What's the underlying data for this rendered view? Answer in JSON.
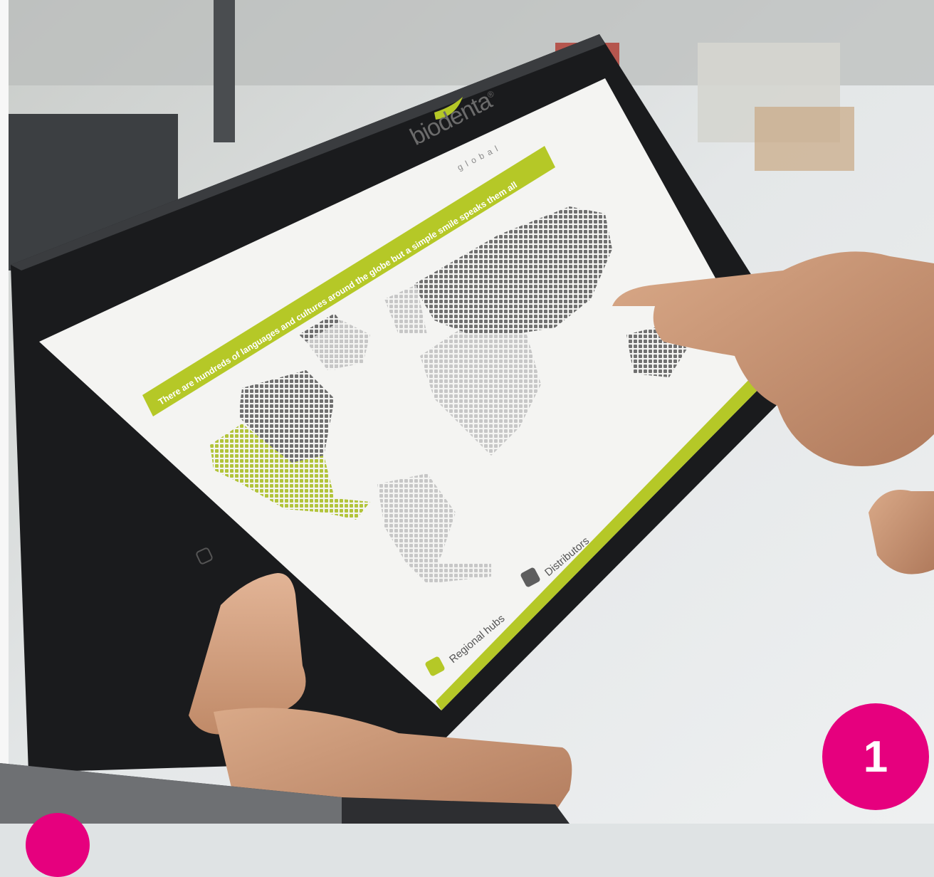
{
  "slide": {
    "logo": {
      "name": "biodenta",
      "registered": "®",
      "sub": "global"
    },
    "headline": "There are hundreds of languages and cultures around the globe but a simple smile speaks them all",
    "legend": [
      {
        "label": "Regional hubs",
        "color": "#b5c827"
      },
      {
        "label": "Distributors",
        "color": "#5e5e5e"
      }
    ]
  },
  "badge": {
    "number": "1"
  },
  "colors": {
    "accent_green": "#b5c827",
    "dark_gray": "#5e5e5e",
    "light_gray": "#c9c9c9",
    "magenta": "#e6007e"
  }
}
